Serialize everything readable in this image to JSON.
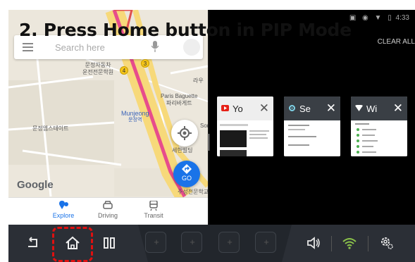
{
  "caption": "2. Press Home button in PIP Mode",
  "status_bar": {
    "time": "4:33"
  },
  "map": {
    "search_placeholder": "Search here",
    "labels": {
      "label1_line1": "문정자동차",
      "label1_line2": "운전전문학원",
      "paris_line1": "Paris Baguette",
      "paris_line2": "파리바게트",
      "munjeong_en": "Munjeong",
      "munjeong_kr": "문정역",
      "east_label": "문정엠스테이트",
      "south_label": "세한빌딩",
      "bottom_label": "주성전문학교",
      "go_label_partial": "GO",
      "partial_right": "라우",
      "partial_son": "Son"
    },
    "route_badges": [
      "4",
      "3"
    ],
    "google": "Google",
    "go_button": "GO",
    "tabs": [
      {
        "label": "Explore",
        "icon": "explore-pin-icon",
        "active": true
      },
      {
        "label": "Driving",
        "icon": "car-icon",
        "active": false
      },
      {
        "label": "Transit",
        "icon": "train-icon",
        "active": false
      }
    ]
  },
  "recents": {
    "clear_all": "CLEAR ALL",
    "cards": [
      {
        "name": "Yo",
        "icon": "youtube-icon",
        "theme": "light"
      },
      {
        "name": "Se",
        "icon": "settings-icon",
        "theme": "dark"
      },
      {
        "name": "Wi",
        "icon": "wifi-icon",
        "theme": "dark"
      }
    ]
  },
  "navbar": {
    "buttons": [
      "back-icon",
      "home-icon",
      "recents-icon"
    ],
    "app_slots": 4,
    "right": [
      "volume-icon",
      "wifi-status-icon",
      "settings-gear-icon"
    ],
    "colors": {
      "wifi": "#8bc34a",
      "highlight": "#e01010"
    }
  }
}
